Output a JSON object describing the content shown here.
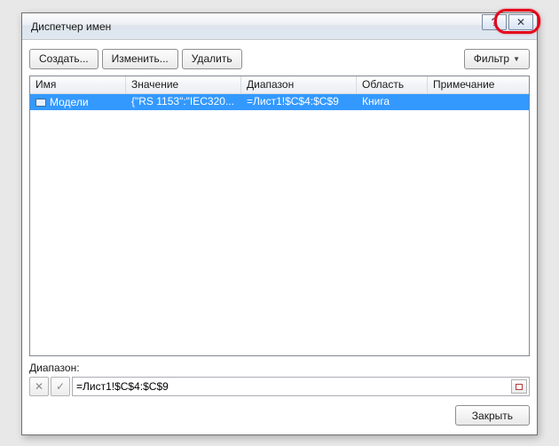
{
  "window": {
    "title": "Диспетчер имен"
  },
  "titlebar": {
    "help_glyph": "?",
    "close_glyph": "✕"
  },
  "toolbar": {
    "create": "Создать...",
    "edit": "Изменить...",
    "delete": "Удалить",
    "filter": "Фильтр"
  },
  "columns": {
    "name": "Имя",
    "value": "Значение",
    "range": "Диапазон",
    "scope": "Область",
    "comment": "Примечание"
  },
  "rows": [
    {
      "name": "Модели",
      "value": "{\"RS 1153\":\"IEC320...",
      "range": "=Лист1!$C$4:$C$9",
      "scope": "Книга",
      "comment": ""
    }
  ],
  "refers": {
    "label": "Диапазон:",
    "cancel_glyph": "✕",
    "accept_glyph": "✓",
    "value": "=Лист1!$C$4:$C$9"
  },
  "footer": {
    "close": "Закрыть"
  }
}
